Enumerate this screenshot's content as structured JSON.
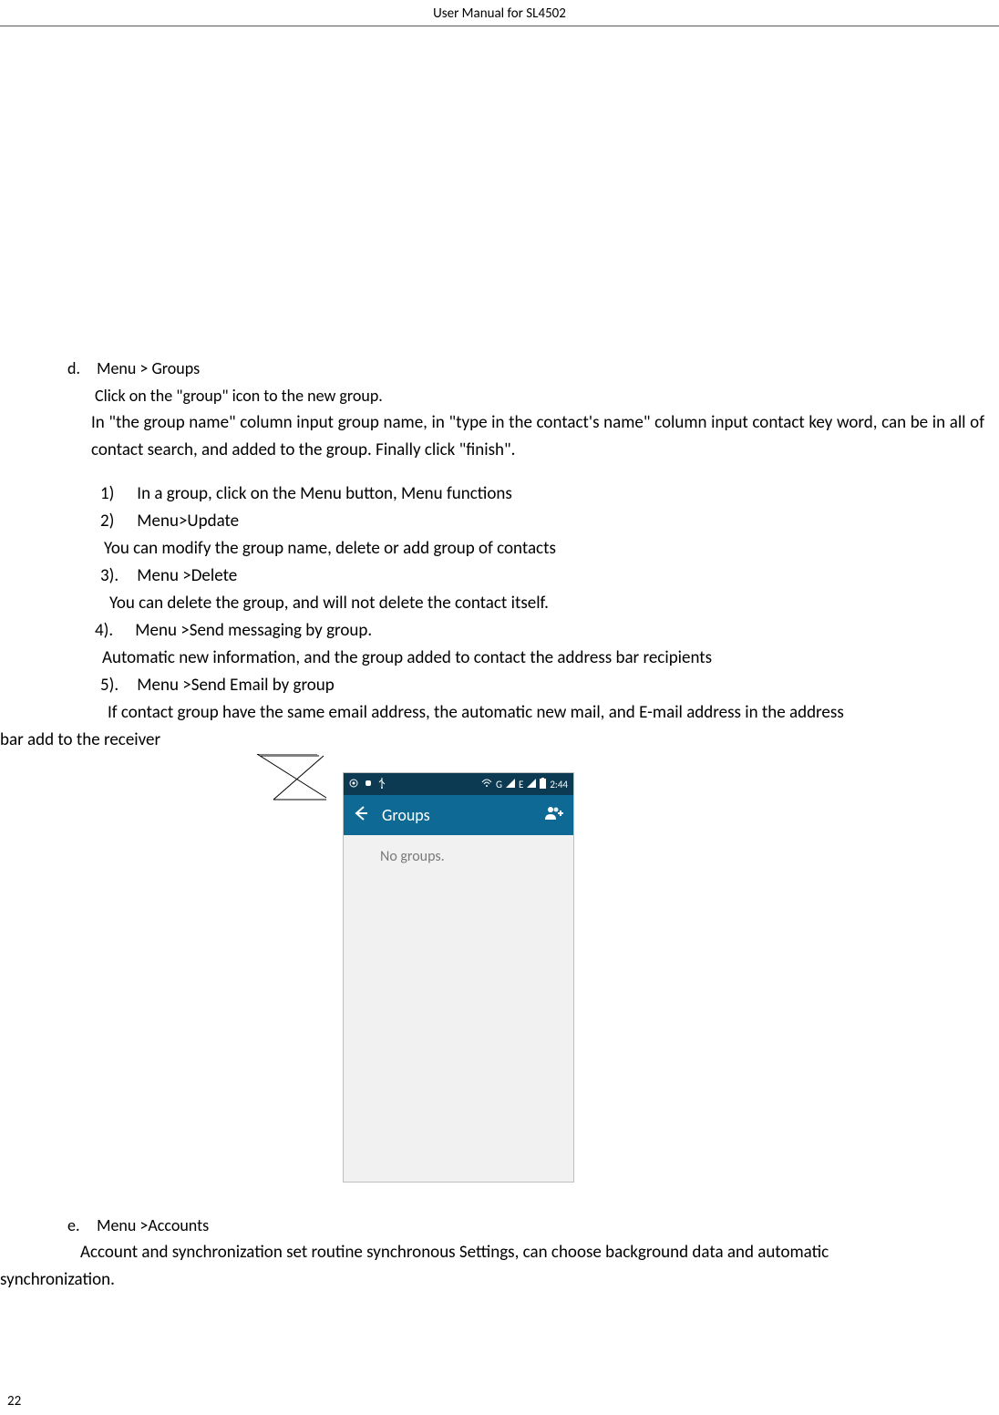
{
  "header": {
    "title": "User Manual for SL4502"
  },
  "section_d": {
    "label": "d.",
    "title": "Menu > Groups",
    "click_line": "Click on the \"group\" icon to the new group.",
    "para1": "In \"the group name\" column input group name, in \"type in the contact's name\" column input contact key word, can be in all of contact search, and added to the group.  Finally click \"finish\".",
    "items": [
      {
        "num": "1)",
        "text": "In a group, click on the Menu button,    Menu functions"
      },
      {
        "num": "2)",
        "text": "Menu>Update"
      }
    ],
    "desc1": "You can modify the group name, delete or add group of contacts",
    "item3": {
      "num": "3).",
      "text": "Menu >Delete"
    },
    "desc2": "You can delete the group, and will not delete the contact itself.",
    "item4": {
      "num": "4).",
      "text": "Menu >Send messaging by group."
    },
    "desc3": "Automatic new information, and the group added to contact the address bar recipients",
    "item5": {
      "num": "5).",
      "text": "Menu >Send Email by group"
    },
    "desc4_first": "If contact group have the same email address, the automatic new mail, and E-mail address in the address",
    "desc4_cont": "bar add to the receiver"
  },
  "phone": {
    "status": {
      "time": "2:44",
      "network": "G",
      "signal_e": "E"
    },
    "appbar": {
      "title": "Groups"
    },
    "body": {
      "empty": "No groups."
    }
  },
  "section_e": {
    "label": "e.",
    "title": "Menu >Accounts",
    "para_first": "Account and synchronization set routine synchronous Settings, can choose background data and automatic",
    "para_cont": "synchronization."
  },
  "page_number": "22"
}
